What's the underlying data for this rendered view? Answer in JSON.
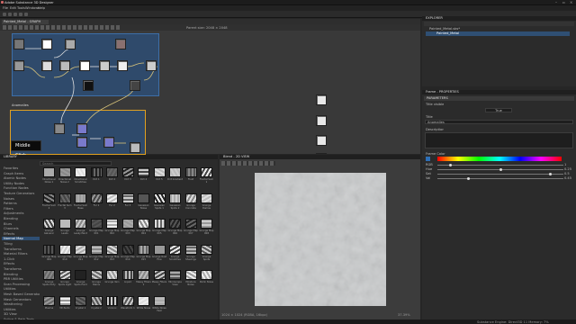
{
  "app": {
    "title": "Adobe Substance 3D Designer"
  },
  "menu": [
    "File",
    "Edit",
    "Tools",
    "Windows",
    "Help"
  ],
  "graph": {
    "tab_label": "Painted_Metal - GRAPH",
    "frame1_title": "",
    "frame2_title": "Anomalies",
    "tooltip": "Middle Click",
    "zoom_readout": "Parent size: 2048 × 2048"
  },
  "explorer": {
    "title": "EXPLORER",
    "items": [
      "Painted_Metal.sbs*",
      "Painted_Metal"
    ]
  },
  "properties": {
    "title": "Frame - PROPERTIES",
    "section": "PARAMETERS",
    "fields": [
      {
        "label": "Title visible",
        "value": "True"
      },
      {
        "label": "Title",
        "value": "Anomalies"
      },
      {
        "label": "Description",
        "value": ""
      },
      {
        "label": "Frame Color",
        "value": ""
      }
    ],
    "color_channels": [
      "RGB",
      "Hue",
      "Sat",
      "Val"
    ],
    "color_values": [
      "1",
      "0.25",
      "0.5",
      "0.45"
    ]
  },
  "library": {
    "title": "LIBRARY",
    "search_placeholder": "Search",
    "categories": [
      "Favorites",
      "Graph Items",
      "Atomic Nodes",
      "Utility Nodes",
      "Function Nodes",
      "Texture Generators",
      "Noises",
      "Patterns",
      "Filters",
      "Adjustments",
      "Blending",
      "Blurs",
      "Channels",
      "Effects",
      "Normal Map",
      "Tiling",
      "Transforms",
      "Material Filters",
      "1-Click",
      "Effects",
      "Transforms",
      "Blending",
      "PBR Utilities",
      "Scan Processing",
      "Utilities",
      "Mesh Based Generators",
      "Mask Generators",
      "Weathering",
      "Utilities",
      "3D View",
      "Spline & Path Tools"
    ],
    "thumbs": [
      [
        "Directional Noise 1",
        "Directional Noise 2",
        "Directional Scratches",
        "Dirt 1",
        "Dirt 2",
        "Dirt 3",
        "Dirt 4",
        "Dirt 5",
        "Dirt Gradient",
        "Fluid",
        "Fractal Sum 1"
      ],
      [
        "Fractal Sum 2",
        "Fractal Sum 3",
        "Fractal Sum Base",
        "Fur 1",
        "Fur 2",
        "Fur 3",
        "Gaussian Noise",
        "Gaussian Spots 1",
        "Gaussian Spots 2",
        "Grunge Concrete",
        "Grunge Damas"
      ],
      [
        "Grunge Galvanic",
        "Grunge Leaks",
        "Grunge Leaky Paint",
        "Grunge Map 001",
        "Grunge Map 002",
        "Grunge Map 003",
        "Grunge Map 004",
        "Grunge Map 005",
        "Grunge Map 006",
        "Grunge Map 007",
        "Grunge Map 008"
      ],
      [
        "Grunge Map 009",
        "Grunge Map 010",
        "Grunge Map 011",
        "Grunge Map 012",
        "Grunge Map 013",
        "Grunge Map 014",
        "Grunge Map 015",
        "Grunge Rust Fine",
        "Grunge Scratches",
        "Grunge Shavings",
        "Grunge Spots"
      ],
      [
        "Grunge Spots Dirty",
        "Grunge Spots Light",
        "Grunge Spots Hard",
        "Grunge Stains",
        "Grunge Vein",
        "Liquid",
        "Messy Fibers 1",
        "Messy Fibers 2",
        "Microscope View",
        "Moisture Noise",
        "Perlin Noise"
      ],
      [
        "Plasma",
        "3D Perlin",
        "Crystal 1",
        "Crystal 2",
        "Voronoi",
        "Waveform 1",
        "White Noise",
        "White Noise Fast"
      ]
    ]
  },
  "view2d": {
    "title": "Blend - 2D VIEW",
    "info": "1024 × 1024 (RGBA, 16bpc)",
    "zoom": "37.39%"
  },
  "status": {
    "left": "",
    "right": "Substance Engine: Direct3D 11   Memory: 7%"
  }
}
